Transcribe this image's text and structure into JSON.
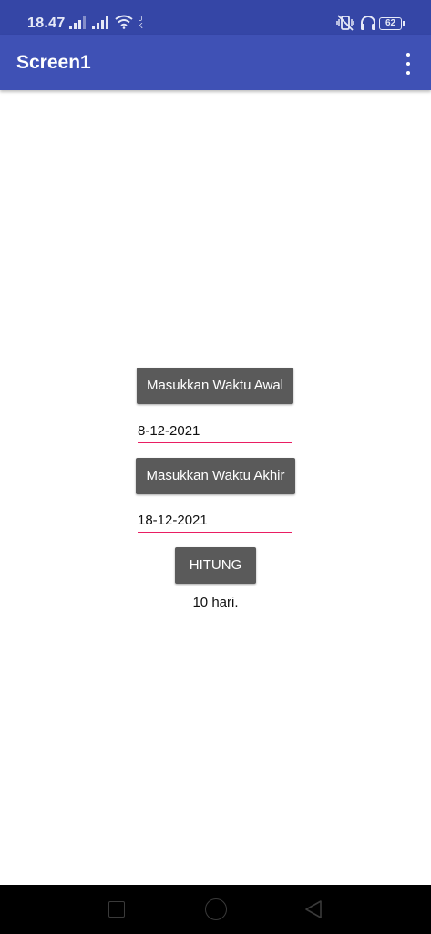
{
  "status_bar": {
    "time": "18.47",
    "battery": "62",
    "icons": [
      "signal-icon",
      "signal-icon",
      "wifi-icon",
      "ok-icon",
      "vibrate-off-icon",
      "headphones-icon",
      "battery-icon"
    ]
  },
  "app_bar": {
    "title": "Screen1",
    "menu_icon": "more-vert-icon"
  },
  "form": {
    "start_button_label": "Masukkan Waktu Awal",
    "start_date_value": "8-12-2021",
    "end_button_label": "Masukkan Waktu Akhir",
    "end_date_value": "18-12-2021",
    "calculate_button_label": "HITUNG",
    "result_text": "10 hari."
  },
  "nav_bar": {
    "icons": [
      "recent-apps-icon",
      "home-icon",
      "back-icon"
    ]
  },
  "colors": {
    "status_bar": "#3546a6",
    "app_bar": "#3f51b5",
    "button": "#5a5a5a",
    "field_underline": "#e91e63"
  }
}
